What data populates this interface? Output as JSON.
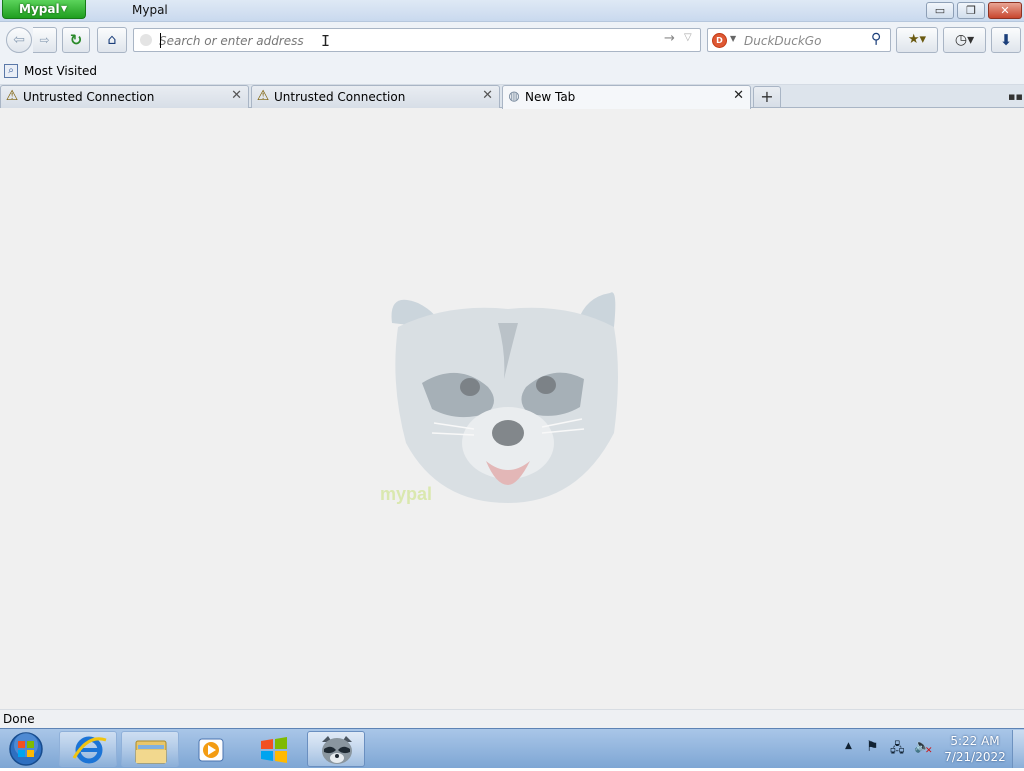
{
  "window": {
    "app_menu_label": "Mypal",
    "title": "Mypal",
    "minimize_symbol": "▭",
    "maximize_symbol": "❐",
    "close_symbol": "✕"
  },
  "navbar": {
    "url_placeholder": "Search or enter address",
    "url_value": "",
    "search_engine": "DuckDuckGo",
    "search_placeholder": "DuckDuckGo"
  },
  "bookmarks_toolbar": {
    "items": [
      {
        "label": "Most Visited",
        "icon": "most-visited-icon"
      }
    ]
  },
  "tabs": [
    {
      "label": "Untrusted Connection",
      "icon": "warning-icon",
      "active": false
    },
    {
      "label": "Untrusted Connection",
      "icon": "warning-icon",
      "active": false
    },
    {
      "label": "New Tab",
      "icon": "globe-icon",
      "active": true
    }
  ],
  "content": {
    "logo": "mypal-raccoon-logo",
    "logo_text": "mypal"
  },
  "status": {
    "text": "Done"
  },
  "taskbar": {
    "items": [
      {
        "name": "internet-explorer",
        "icon": "ie-icon"
      },
      {
        "name": "windows-explorer",
        "icon": "folder-icon"
      },
      {
        "name": "media-player",
        "icon": "media-player-icon"
      },
      {
        "name": "windows",
        "icon": "windows-logo-icon"
      },
      {
        "name": "mypal",
        "icon": "raccoon-icon",
        "active": true
      }
    ],
    "clock": {
      "time": "5:22 AM",
      "date": "7/21/2022"
    }
  },
  "colors": {
    "app_menu": "#1f9e1f",
    "close_button": "#c8462e",
    "warning": "#f5c400",
    "duckduckgo": "#de5833",
    "page_bg": "#f0f0f0"
  }
}
